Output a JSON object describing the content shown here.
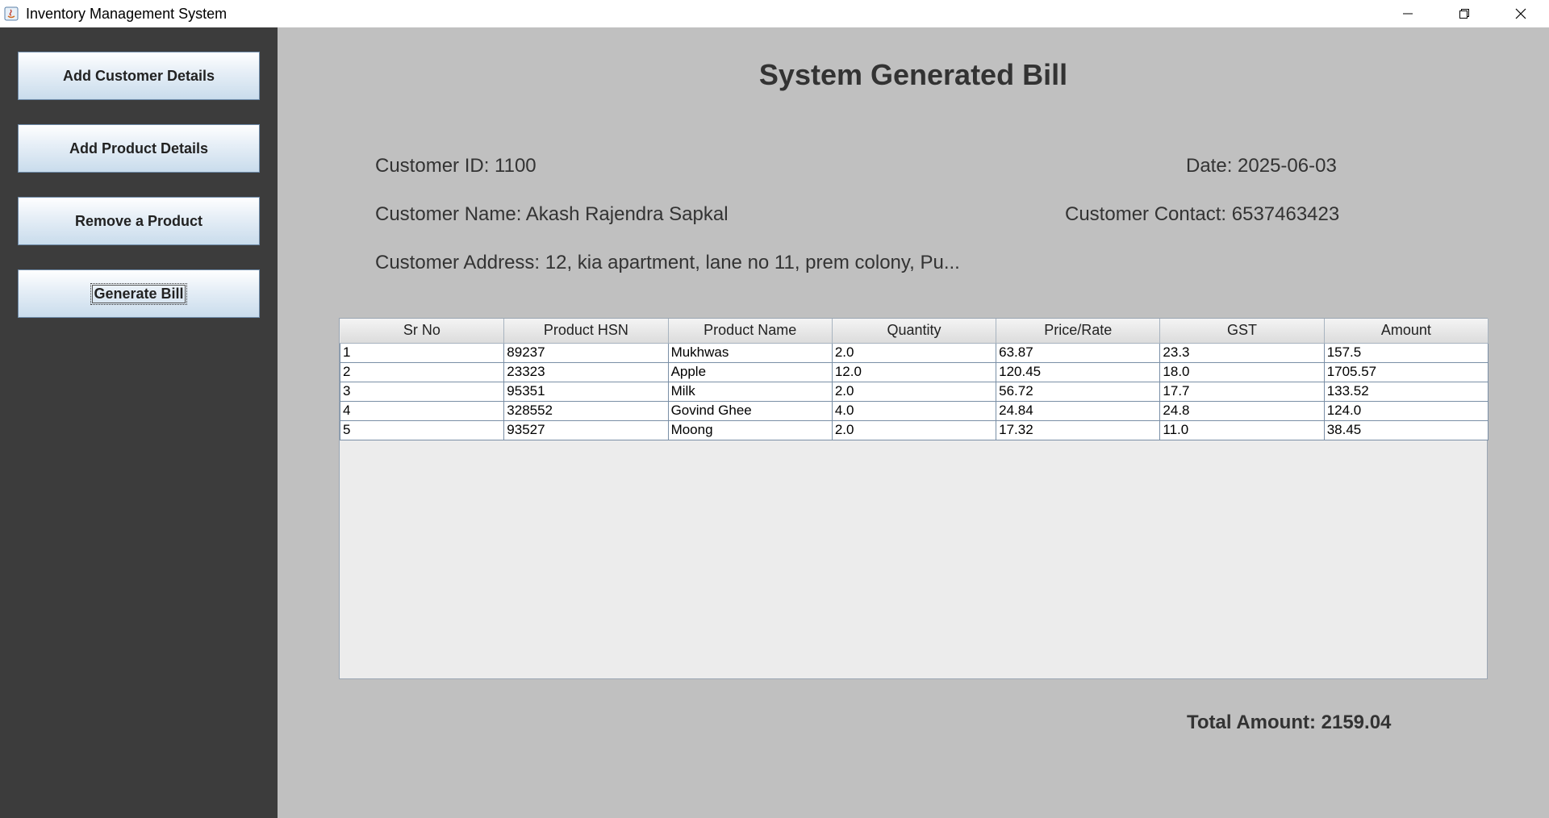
{
  "window": {
    "title": "Inventory Management System",
    "controls": [
      "minimize",
      "restore",
      "close"
    ]
  },
  "sidebar": {
    "buttons": [
      {
        "label": "Add Customer Details"
      },
      {
        "label": "Add Product Details"
      },
      {
        "label": "Remove a Product"
      },
      {
        "label": "Generate Bill"
      }
    ]
  },
  "bill": {
    "title": "System Generated Bill",
    "customer_id": "Customer ID: 1100",
    "date": "Date: 2025-06-03",
    "customer_name": "Customer Name: Akash Rajendra Sapkal",
    "customer_contact": "Customer Contact: 6537463423",
    "customer_address": "Customer Address: 12, kia apartment, lane no 11, prem colony, Pu...",
    "total": "Total Amount: 2159.04"
  },
  "table": {
    "headers": [
      "Sr No",
      "Product HSN",
      "Product Name",
      "Quantity",
      "Price/Rate",
      "GST",
      "Amount"
    ],
    "rows": [
      [
        "1",
        "89237",
        "Mukhwas",
        "2.0",
        "63.87",
        "23.3",
        "157.5"
      ],
      [
        "2",
        "23323",
        "Apple",
        "12.0",
        "120.45",
        "18.0",
        "1705.57"
      ],
      [
        "3",
        "95351",
        "Milk",
        "2.0",
        "56.72",
        "17.7",
        "133.52"
      ],
      [
        "4",
        "328552",
        "Govind Ghee",
        "4.0",
        "24.84",
        "24.8",
        "124.0"
      ],
      [
        "5",
        "93527",
        "Moong",
        "2.0",
        "17.32",
        "11.0",
        "38.45"
      ]
    ]
  },
  "colors": {
    "sidebar_bg": "#3c3c3c",
    "main_bg": "#c0c0c0",
    "table_bg": "#ececec"
  }
}
